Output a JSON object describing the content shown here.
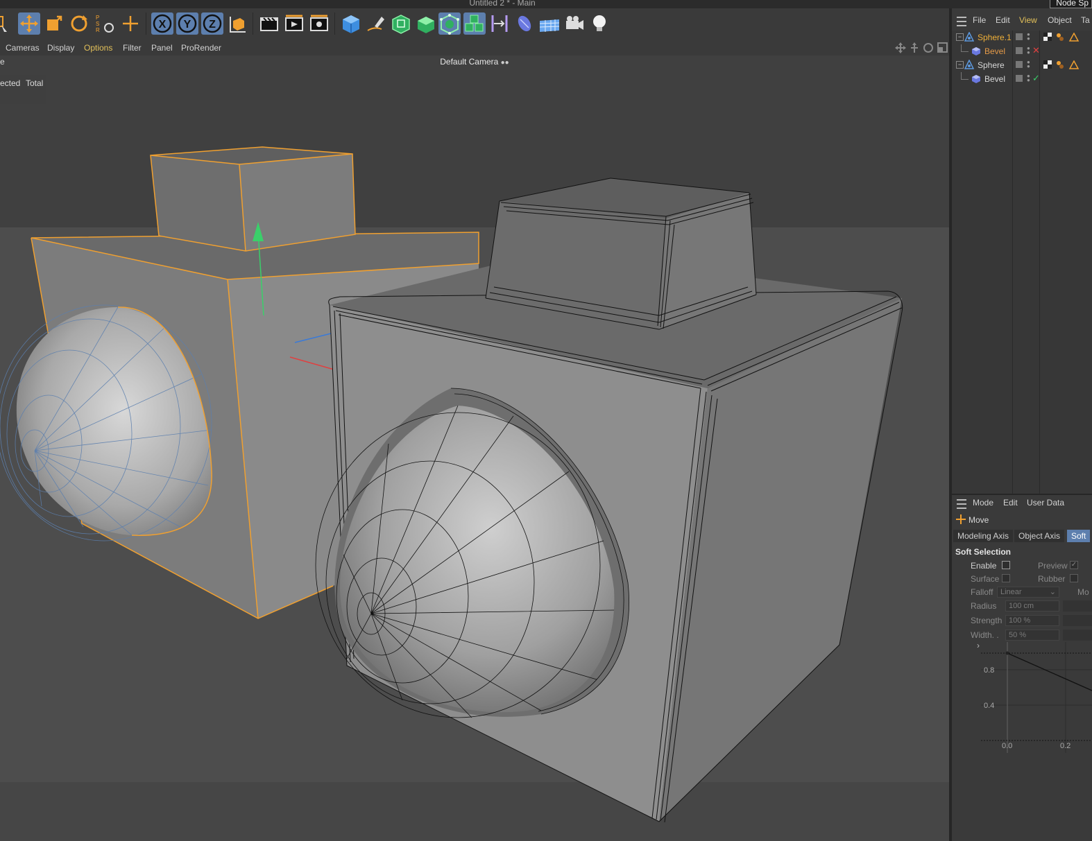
{
  "window": {
    "title": "Untitled 2 * - Main",
    "node_space_label": "Node Sp"
  },
  "toolbar": {
    "psr_label": "P S R",
    "axis_x": "X",
    "axis_y": "Y",
    "axis_z": "Z",
    "tools": [
      "live-selection",
      "move",
      "scale",
      "rotate",
      "psr-reset",
      "recent-tool",
      "x-axis-lock",
      "y-axis-lock",
      "z-axis-lock",
      "coordinate-system",
      "render-view",
      "render-to-picture-viewer",
      "render-settings",
      "cube",
      "pen",
      "subdivision-surface",
      "extrude",
      "array",
      "cloner",
      "symmetry",
      "deformer",
      "floor",
      "camera",
      "light"
    ]
  },
  "viewport_menu": {
    "items": [
      "Cameras",
      "Display",
      "Options",
      "Filter",
      "Panel",
      "ProRender"
    ],
    "highlighted": "Options"
  },
  "viewport": {
    "camera_label": "Default Camera",
    "hud_partial_label": "e",
    "stats_selected": "ected",
    "stats_total": "Total"
  },
  "object_manager": {
    "menu": [
      "File",
      "Edit",
      "View",
      "Object",
      "Ta"
    ],
    "highlighted_menu": "View",
    "objects": [
      {
        "name": "Sphere.1",
        "color": "#f0b038",
        "indent": 0,
        "type": "sphere",
        "status": "warning"
      },
      {
        "name": "Bevel",
        "color": "#e49a48",
        "indent": 1,
        "type": "bevel",
        "status": "disabled"
      },
      {
        "name": "Sphere",
        "color": "#d8d8d8",
        "indent": 0,
        "type": "sphere",
        "status": "warning"
      },
      {
        "name": "Bevel",
        "color": "#d8d8d8",
        "indent": 1,
        "type": "bevel",
        "status": "enabled"
      }
    ]
  },
  "attribute_manager": {
    "menu": [
      "Mode",
      "Edit",
      "User Data"
    ],
    "tool_name": "Move",
    "tabs": [
      "Modeling Axis",
      "Object Axis",
      "Soft"
    ],
    "selected_tab": "Soft",
    "section_title": "Soft Selection",
    "enable_label": "Enable",
    "preview_label": "Preview",
    "surface_label": "Surface",
    "rubber_label": "Rubber",
    "falloff_label": "Falloff",
    "falloff_value": "Linear",
    "mode_partial": "Mo",
    "radius_label": "Radius",
    "radius_value": "100 cm",
    "strength_label": "Strength",
    "strength_value": "100 %",
    "width_label": "Width. .",
    "width_value": "50 %",
    "graph": {
      "y_ticks": [
        "0.8",
        "0.4"
      ],
      "x_ticks": [
        "0.0",
        "0.2"
      ]
    }
  },
  "colors": {
    "accent": "#5d7fae",
    "highlight": "#e2c05a",
    "selection_orange": "#f0a030",
    "axis_green": "#3ad06a",
    "axis_blue": "#3a7ad8",
    "axis_red": "#e04040"
  }
}
